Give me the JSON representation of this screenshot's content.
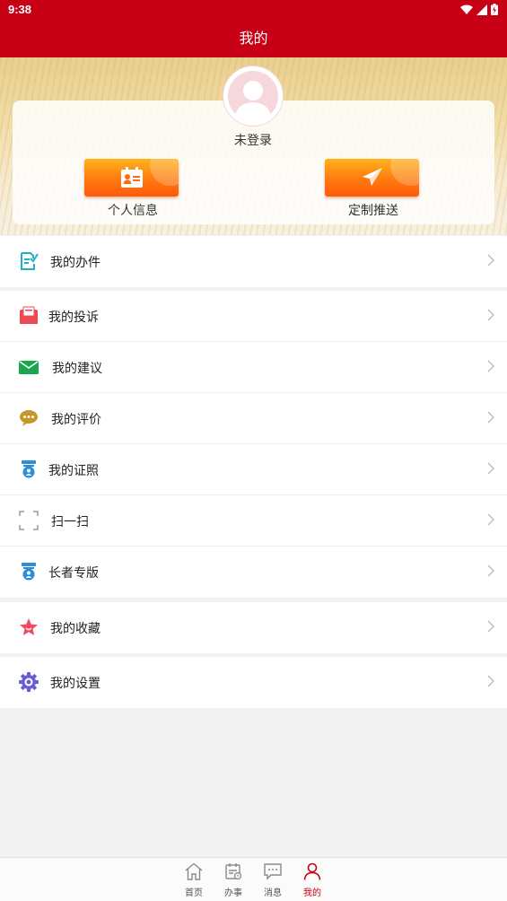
{
  "status": {
    "time": "9:38"
  },
  "header": {
    "title": "我的"
  },
  "profile": {
    "login_status": "未登录"
  },
  "actions": [
    {
      "label": "个人信息",
      "icon": "id-card-icon"
    },
    {
      "label": "定制推送",
      "icon": "paper-plane-icon"
    }
  ],
  "menu": [
    {
      "label": "我的办件",
      "icon": "document-check-icon",
      "color": "#1fb0c7"
    },
    {
      "label": "我的投诉",
      "icon": "mail-envelope-icon",
      "color": "#ec4b56"
    },
    {
      "label": "我的建议",
      "icon": "envelope-icon",
      "color": "#1aa64c"
    },
    {
      "label": "我的评价",
      "icon": "chat-bubble-icon",
      "color": "#c9962a"
    },
    {
      "label": "我的证照",
      "icon": "certificate-badge-icon",
      "color": "#2c8fd6"
    },
    {
      "label": "扫一扫",
      "icon": "scan-icon",
      "color": "#999999"
    },
    {
      "label": "长者专版",
      "icon": "elder-badge-icon",
      "color": "#2c8fd6"
    },
    {
      "label": "我的收藏",
      "icon": "star-icon",
      "color": "#ee4b63"
    },
    {
      "label": "我的设置",
      "icon": "gear-icon",
      "color": "#6b5fd0"
    }
  ],
  "tabs": [
    {
      "label": "首页",
      "icon": "home-icon",
      "active": false
    },
    {
      "label": "办事",
      "icon": "calendar-task-icon",
      "active": false
    },
    {
      "label": "消息",
      "icon": "message-icon",
      "active": false
    },
    {
      "label": "我的",
      "icon": "user-icon",
      "active": true
    }
  ],
  "colors": {
    "brand": "#c70016",
    "accent": "#ff7a10"
  }
}
